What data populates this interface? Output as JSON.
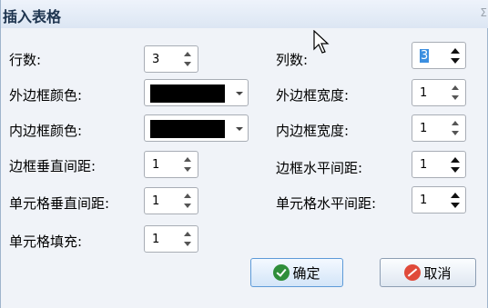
{
  "window": {
    "title": "插入表格",
    "close_glyph": "Σ"
  },
  "labels": {
    "rows": "行数:",
    "cols": "列数:",
    "outer_border_color": "外边框颜色:",
    "outer_border_width": "外边框宽度:",
    "inner_border_color": "内边框颜色:",
    "inner_border_width": "内边框宽度:",
    "border_v_spacing": "边框垂直间距:",
    "border_h_spacing": "边框水平间距:",
    "cell_v_spacing": "单元格垂直间距:",
    "cell_h_spacing": "单元格水平间距:",
    "cell_padding": "单元格填充:"
  },
  "values": {
    "rows": "3",
    "cols": "3",
    "outer_border_width": "1",
    "inner_border_width": "1",
    "border_v_spacing": "1",
    "border_h_spacing": "1",
    "cell_v_spacing": "1",
    "cell_h_spacing": "1",
    "cell_padding": "1"
  },
  "colors": {
    "outer_border_color": "#000000",
    "inner_border_color": "#000000"
  },
  "icons": {
    "ok": "check-circle-icon",
    "cancel": "no-entry-icon",
    "spin": "up-down-arrows-icon",
    "dropdown": "caret-down-icon"
  },
  "buttons": {
    "ok": "确定",
    "cancel": "取消"
  }
}
